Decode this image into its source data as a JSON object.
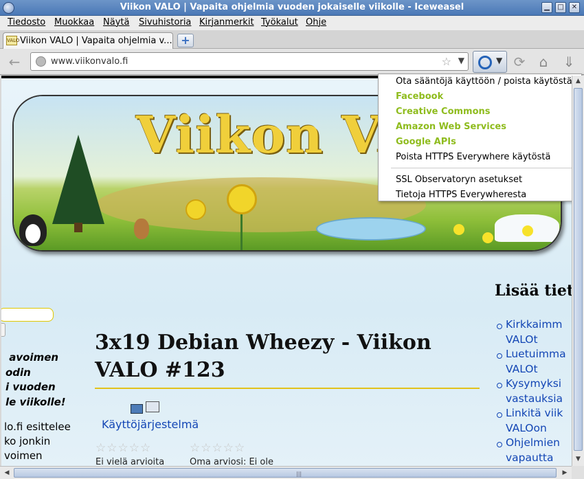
{
  "window": {
    "title": "Viikon VALO | Vapaita ohjelmia vuoden jokaiselle viikolle - Iceweasel",
    "minimize": "▁",
    "maximize": "□",
    "close": "✕"
  },
  "menubar": {
    "items": [
      {
        "label": "Tiedosto"
      },
      {
        "label": "Muokkaa"
      },
      {
        "label": "Näytä"
      },
      {
        "label": "Sivuhistoria"
      },
      {
        "label": "Kirjanmerkit"
      },
      {
        "label": "Työkalut"
      },
      {
        "label": "Ohje"
      }
    ]
  },
  "tabs": {
    "active_label": "Viikon VALO | Vapaita ohjelmia v...",
    "new_tab": "+"
  },
  "navbar": {
    "url": "www.viikonvalo.fi",
    "back_icon": "←",
    "reload_icon": "⟳",
    "home_icon": "⌂",
    "download_icon": "⇓"
  },
  "banner": {
    "title": "Viikon VALO"
  },
  "sidebar_left": {
    "slogan": " avoimen\nodin\ni vuoden\nle viikolle!",
    "intro": "lo.fi esittelee\nko jonkin\nvoimen"
  },
  "post": {
    "title": "3x19 Debian Wheezy - Viikon VALO #123",
    "category": "Käyttöjärjestelmä",
    "rating_stars": "☆☆☆☆☆",
    "rating_note": "Ei vielä arvioita",
    "own_rating": "Oma arviosi: Ei ole"
  },
  "sidebar_right": {
    "title": "Lisää tiet",
    "links": [
      "Kirkkaimm\nVALOt",
      "Luetuimma\nVALOt",
      "Kysymyksi\nvastauksia",
      "Linkitä viik\nVALOon",
      "Ohjelmien\nvapautta"
    ]
  },
  "https_menu": {
    "toggle_rules": "Ota sääntöjä käyttöön / poista käytöstä",
    "rules": [
      {
        "label": "Facebook"
      },
      {
        "label": "Creative Commons"
      },
      {
        "label": "Amazon Web Services"
      },
      {
        "label": "Google APIs"
      }
    ],
    "disable": "Poista HTTPS Everywhere käytöstä",
    "ssl_settings": "SSL Observatoryn asetukset",
    "about": "Tietoja HTTPS Everywheresta",
    "rule_color": "#8fbc1e"
  }
}
